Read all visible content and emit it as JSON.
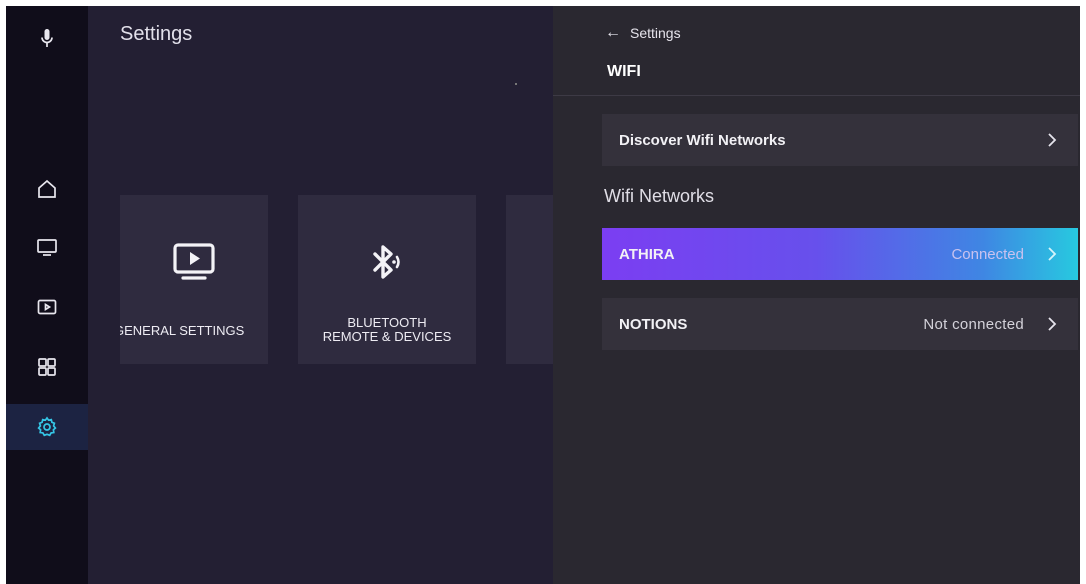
{
  "nav": {
    "items": [
      {
        "icon": "microphone-icon"
      },
      {
        "icon": "home-icon"
      },
      {
        "icon": "tv-icon"
      },
      {
        "icon": "media-player-icon"
      },
      {
        "icon": "apps-grid-icon"
      },
      {
        "icon": "gear-icon",
        "active": true
      }
    ],
    "active_color": "#35c6e6"
  },
  "main": {
    "title": "Settings",
    "tiles": [
      {
        "label": "GENERAL SETTINGS",
        "icon": "tv-play-icon"
      },
      {
        "label": "BLUETOOTH\nREMOTE & DEVICES",
        "icon": "bluetooth-icon"
      }
    ]
  },
  "panel": {
    "back_label": "Settings",
    "title": "WIFI",
    "discover_label": "Discover Wifi Networks",
    "section_label": "Wifi Networks",
    "networks": [
      {
        "name": "ATHIRA",
        "status": "Connected",
        "selected": true
      },
      {
        "name": "NOTIONS",
        "status": "Not connected",
        "selected": false
      }
    ],
    "highlight_gradient": [
      "#7b3ef2",
      "#27c9e0"
    ]
  }
}
